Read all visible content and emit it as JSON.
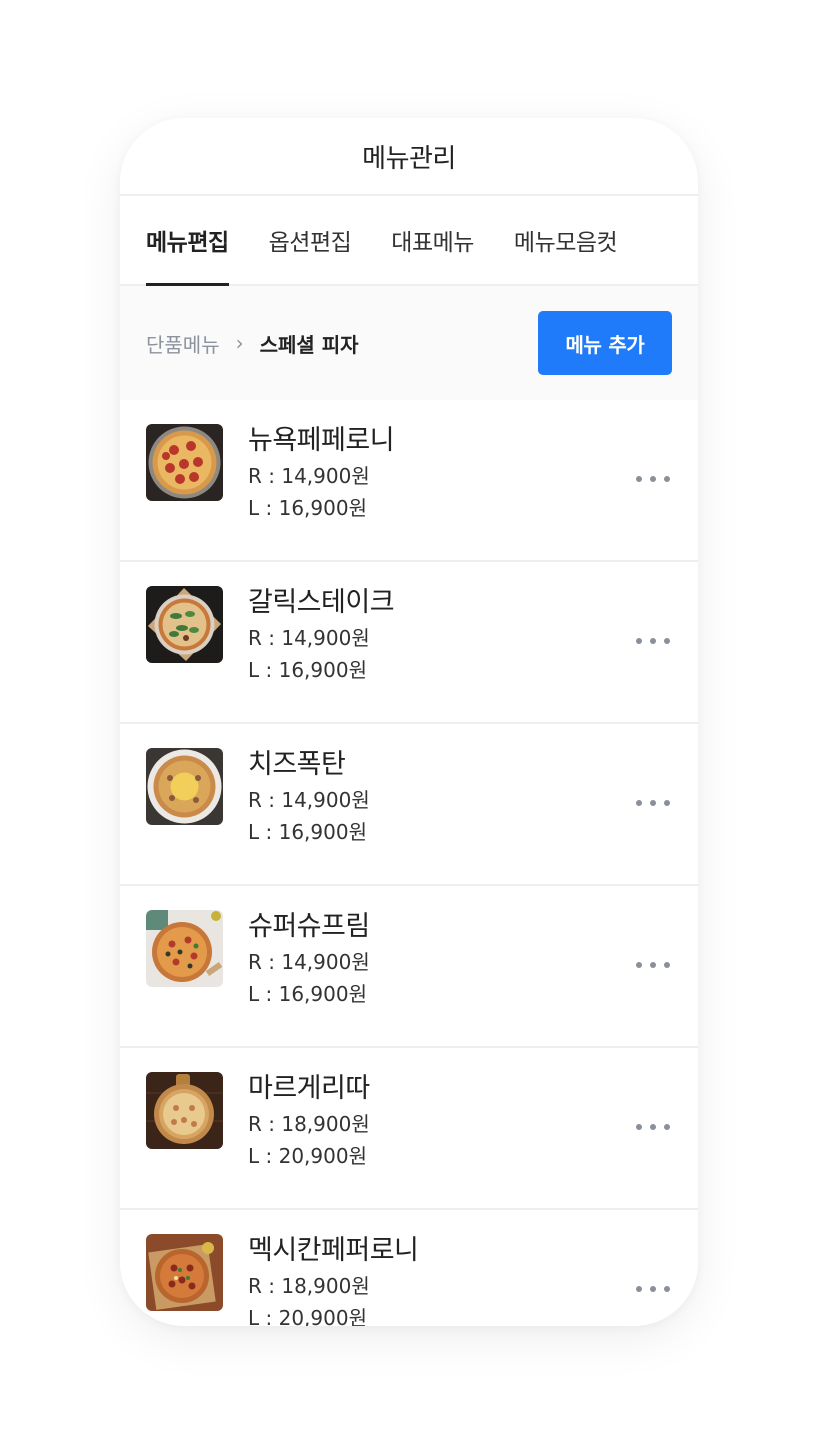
{
  "header": {
    "title": "메뉴관리"
  },
  "tabs": [
    {
      "label": "메뉴편집",
      "active": true
    },
    {
      "label": "옵션편집",
      "active": false
    },
    {
      "label": "대표메뉴",
      "active": false
    },
    {
      "label": "메뉴모음컷",
      "active": false
    }
  ],
  "breadcrumb": {
    "root": "단품메뉴",
    "separator": "›",
    "current": "스페셜 피자"
  },
  "add_button": {
    "label": "메뉴 추가",
    "color": "#1f7bf9"
  },
  "menu_items": [
    {
      "name": "뉴욕페페로니",
      "price_r": "R : 14,900원",
      "price_l": "L : 16,900원",
      "icon": "pizza-pepperoni-photo"
    },
    {
      "name": "갈릭스테이크",
      "price_r": "R : 14,900원",
      "price_l": "L : 16,900원",
      "icon": "pizza-garlic-steak-photo"
    },
    {
      "name": "치즈폭탄",
      "price_r": "R : 14,900원",
      "price_l": "L : 16,900원",
      "icon": "pizza-cheese-photo"
    },
    {
      "name": "슈퍼슈프림",
      "price_r": "R : 14,900원",
      "price_l": "L : 16,900원",
      "icon": "pizza-supreme-photo"
    },
    {
      "name": "마르게리따",
      "price_r": "R : 18,900원",
      "price_l": "L : 20,900원",
      "icon": "pizza-margherita-photo"
    },
    {
      "name": "멕시칸페퍼로니",
      "price_r": "R : 18,900원",
      "price_l": "L : 20,900원",
      "icon": "pizza-mexican-pepperoni-photo"
    }
  ]
}
